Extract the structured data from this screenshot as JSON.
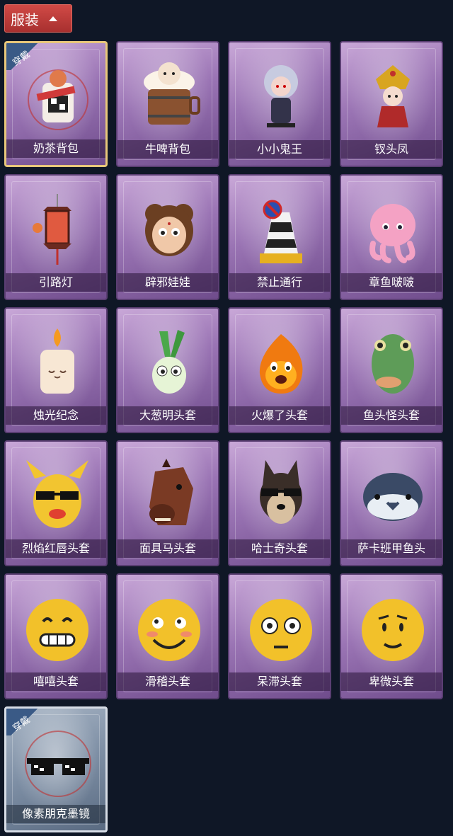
{
  "header": {
    "title": "服装"
  },
  "badge_text": "穿戴",
  "items": [
    {
      "label": "奶茶背包",
      "icon": "milk-tea-backpack-icon",
      "equipped": true,
      "frame": "gold"
    },
    {
      "label": "牛啤背包",
      "icon": "beer-barrel-backpack-icon",
      "equipped": false
    },
    {
      "label": "小小鬼王",
      "icon": "ghost-king-figure-icon",
      "equipped": false
    },
    {
      "label": "钗头凤",
      "icon": "phoenix-crown-figure-icon",
      "equipped": false
    },
    {
      "label": "引路灯",
      "icon": "red-lantern-icon",
      "equipped": false
    },
    {
      "label": "辟邪娃娃",
      "icon": "doll-head-icon",
      "equipped": false
    },
    {
      "label": "禁止通行",
      "icon": "traffic-cone-icon",
      "equipped": false
    },
    {
      "label": "章鱼啵啵",
      "icon": "pink-octopus-icon",
      "equipped": false
    },
    {
      "label": "烛光纪念",
      "icon": "candle-icon",
      "equipped": false
    },
    {
      "label": "大葱明头套",
      "icon": "green-onion-head-icon",
      "equipped": false
    },
    {
      "label": "火爆了头套",
      "icon": "fireball-head-icon",
      "equipped": false
    },
    {
      "label": "鱼头怪头套",
      "icon": "fish-head-mask-icon",
      "equipped": false
    },
    {
      "label": "烈焰红唇头套",
      "icon": "yellow-rabbit-mask-icon",
      "equipped": false
    },
    {
      "label": "面具马头套",
      "icon": "horse-head-mask-icon",
      "equipped": false
    },
    {
      "label": "哈士奇头套",
      "icon": "husky-head-mask-icon",
      "equipped": false
    },
    {
      "label": "萨卡班甲鱼头",
      "icon": "sacabambaspis-head-icon",
      "equipped": false
    },
    {
      "label": "嘻嘻头套",
      "icon": "grin-emoji-head-icon",
      "equipped": false
    },
    {
      "label": "滑稽头套",
      "icon": "smirk-emoji-head-icon",
      "equipped": false
    },
    {
      "label": "呆滞头套",
      "icon": "blank-stare-emoji-head-icon",
      "equipped": false
    },
    {
      "label": "卑微头套",
      "icon": "meek-emoji-head-icon",
      "equipped": false
    },
    {
      "label": "像素朋克墨镜",
      "icon": "pixel-sunglasses-icon",
      "equipped": true,
      "frame": "blue"
    }
  ]
}
